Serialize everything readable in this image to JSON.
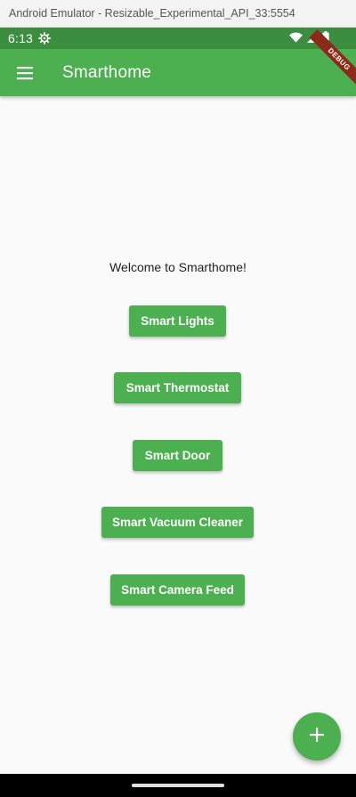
{
  "window": {
    "title": "Android Emulator - Resizable_Experimental_API_33:5554"
  },
  "status_bar": {
    "time": "6:13",
    "icons": [
      "settings-gear-icon",
      "wifi-icon",
      "signal-icon",
      "battery-icon"
    ]
  },
  "app_bar": {
    "title": "Smarthome",
    "menu_icon": "hamburger-menu-icon",
    "color": "#4caf50"
  },
  "debug_banner": "DEBUG",
  "main": {
    "welcome": "Welcome to Smarthome!",
    "buttons": [
      {
        "label": "Smart Lights"
      },
      {
        "label": "Smart Thermostat"
      },
      {
        "label": "Smart Door"
      },
      {
        "label": "Smart Vacuum Cleaner"
      },
      {
        "label": "Smart Camera Feed"
      }
    ]
  },
  "fab": {
    "icon": "add-icon"
  },
  "colors": {
    "primary": "#4caf50",
    "status_bar": "#3b8e3f",
    "background": "#fafafa"
  }
}
